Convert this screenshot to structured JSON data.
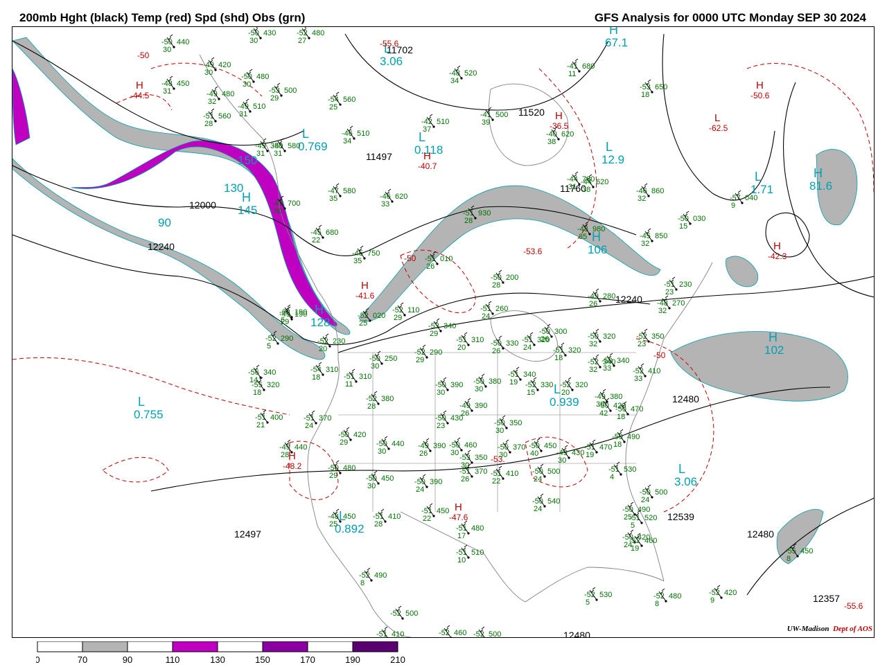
{
  "header": {
    "left_title": "200mb Hght (black) Temp (red) Spd (shd) Obs (grn)",
    "right_title": "GFS Analysis for 0000 UTC Monday  SEP 30 2024"
  },
  "credit": {
    "org": "UW-Madison",
    "dept": "Dept of AOS"
  },
  "colors": {
    "height_contour": "#000000",
    "temp_contour": "#c00000",
    "obs": "#007000",
    "speed_label": "#00a0b0",
    "speed_70_90": "#b4b4b4",
    "speed_110_130": "#c000c0",
    "speed_150_170": "#8a00a0",
    "speed_190_210": "#5a0070",
    "coastline": "#808080"
  },
  "legend": {
    "ticks": [
      "0",
      "70",
      "90",
      "110",
      "130",
      "150",
      "170",
      "190",
      "210"
    ],
    "bins": [
      {
        "label_from": "70",
        "label_to": "90",
        "color": "#b4b4b4"
      },
      {
        "label_from": "110",
        "label_to": "130",
        "color": "#c000c0"
      },
      {
        "label_from": "150",
        "label_to": "170",
        "color": "#8a00a0"
      },
      {
        "label_from": "190",
        "label_to": "210",
        "color": "#5a0070"
      }
    ]
  },
  "height_labels": [
    "11702",
    "11497",
    "11520",
    "11760",
    "12000",
    "12240",
    "12240",
    "12480",
    "12497",
    "12539",
    "12480",
    "12357",
    "12480"
  ],
  "speed_centers": [
    {
      "type": "L",
      "value": "3.06"
    },
    {
      "type": "H",
      "value": "67.1"
    },
    {
      "type": "L",
      "value": "0.769"
    },
    {
      "type": "L",
      "value": "0.118"
    },
    {
      "type": "L",
      "value": "12.9"
    },
    {
      "type": "L",
      "value": "1.71"
    },
    {
      "type": "H",
      "value": "81.6"
    },
    {
      "type": "H",
      "value": "145"
    },
    {
      "type": "H",
      "value": "106"
    },
    {
      "type": "H",
      "value": "128"
    },
    {
      "type": "H",
      "value": "102"
    },
    {
      "type": "L",
      "value": "0.755"
    },
    {
      "type": "L",
      "value": "0.939"
    },
    {
      "type": "L",
      "value": "3.06"
    },
    {
      "type": "L",
      "value": "0.892"
    },
    {
      "type": "",
      "value": "90"
    },
    {
      "type": "",
      "value": "130"
    },
    {
      "type": "",
      "value": "150"
    }
  ],
  "temp_centers": [
    {
      "type": "H",
      "value": "-44.5"
    },
    {
      "type": "H",
      "value": "-50.6"
    },
    {
      "type": "L",
      "value": "-62.5"
    },
    {
      "type": "H",
      "value": "-36.5"
    },
    {
      "type": "H",
      "value": "-40.7"
    },
    {
      "type": "H",
      "value": "-41.6"
    },
    {
      "type": "H",
      "value": "-42.3"
    },
    {
      "type": "H",
      "value": "-48.2"
    },
    {
      "type": "H",
      "value": "-47.6"
    },
    {
      "type": "",
      "value": "-53.6"
    },
    {
      "type": "",
      "value": "-53."
    },
    {
      "type": "",
      "value": "-55.6"
    },
    {
      "type": "",
      "value": "-55.6"
    },
    {
      "type": "",
      "value": "-50"
    },
    {
      "type": "",
      "value": "-50"
    },
    {
      "type": "",
      "value": "-50"
    }
  ],
  "observations": [
    {
      "t": "-50",
      "d": "30",
      "h": "440"
    },
    {
      "t": "-49",
      "d": "30",
      "h": "420"
    },
    {
      "t": "-48",
      "d": "31",
      "h": "450"
    },
    {
      "t": "-49",
      "d": "32",
      "h": "480"
    },
    {
      "t": "-50",
      "d": "30",
      "h": "480"
    },
    {
      "t": "-53",
      "d": "29",
      "h": "500"
    },
    {
      "t": "-49",
      "d": "31",
      "h": "510"
    },
    {
      "t": "-54",
      "d": "25",
      "h": "560"
    },
    {
      "t": "-51",
      "d": "28",
      "h": "560"
    },
    {
      "t": "-49",
      "d": "31",
      "h": "350"
    },
    {
      "t": "-52",
      "d": "27",
      "h": "480"
    },
    {
      "t": "-50",
      "d": "30",
      "h": "430"
    },
    {
      "t": "-48",
      "d": "34",
      "h": "520"
    },
    {
      "t": "-42",
      "d": "37",
      "h": "510"
    },
    {
      "t": "-46",
      "d": "34",
      "h": "510"
    },
    {
      "t": "-41",
      "d": "39",
      "h": "500"
    },
    {
      "t": "-41",
      "d": "11",
      "h": "680"
    },
    {
      "t": "-53",
      "d": "18",
      "h": "650"
    },
    {
      "t": "-40",
      "d": "38",
      "h": "620"
    },
    {
      "t": "-44",
      "d": "38",
      "h": "620"
    },
    {
      "t": "-44",
      "d": "31",
      "h": "760"
    },
    {
      "t": "-46",
      "d": "32",
      "h": "860"
    },
    {
      "t": "-57",
      "d": "9",
      "h": "040"
    },
    {
      "t": "-50",
      "d": "15",
      "h": "030"
    },
    {
      "t": "-45",
      "d": "32",
      "h": "850"
    },
    {
      "t": "-48",
      "d": "35",
      "h": "980"
    },
    {
      "t": "-47",
      "d": "35",
      "h": "580"
    },
    {
      "t": "-46",
      "d": "33",
      "h": "620"
    },
    {
      "t": "-45",
      "d": "22",
      "h": "680"
    },
    {
      "t": "-45",
      "d": "35",
      "h": "750"
    },
    {
      "t": "-49",
      "d": "30",
      "h": "700"
    },
    {
      "t": "-41",
      "d": "31",
      "h": "580"
    },
    {
      "t": "-51",
      "d": "26",
      "h": "010"
    },
    {
      "t": "-51",
      "d": "28",
      "h": "930"
    },
    {
      "t": "-50",
      "d": "28",
      "h": "200"
    },
    {
      "t": "-49",
      "d": "26",
      "h": "280"
    },
    {
      "t": "-51",
      "d": "24",
      "h": "260"
    },
    {
      "t": "-48",
      "d": "32",
      "h": "270"
    },
    {
      "t": "-51",
      "d": "23",
      "h": "230"
    },
    {
      "t": "-49",
      "d": "29",
      "h": "190"
    },
    {
      "t": "-52",
      "d": "25",
      "h": "020"
    },
    {
      "t": "-52",
      "d": "29",
      "h": "110"
    },
    {
      "t": "-53",
      "d": "29",
      "h": "340"
    },
    {
      "t": "-51",
      "d": "20",
      "h": "310"
    },
    {
      "t": "-50",
      "d": "26",
      "h": "330"
    },
    {
      "t": "-51",
      "d": "24",
      "h": "320"
    },
    {
      "t": "-50",
      "d": "26",
      "h": "300"
    },
    {
      "t": "-51",
      "d": "18",
      "h": "320"
    },
    {
      "t": "-50",
      "d": "32",
      "h": "320"
    },
    {
      "t": "-52",
      "d": "23",
      "h": "350"
    },
    {
      "t": "-52",
      "d": "32",
      "h": "340"
    },
    {
      "t": "-52",
      "d": "33",
      "h": "410"
    },
    {
      "t": "-62",
      "d": "6",
      "h": "190"
    },
    {
      "t": "-52",
      "d": "5",
      "h": "290"
    },
    {
      "t": "-52",
      "d": "20",
      "h": "230"
    },
    {
      "t": "-50",
      "d": "30",
      "h": "250"
    },
    {
      "t": "-52",
      "d": "29",
      "h": "290"
    },
    {
      "t": "-56",
      "d": "14",
      "h": "340"
    },
    {
      "t": "-54",
      "d": "18",
      "h": "310"
    },
    {
      "t": "-51",
      "d": "11",
      "h": "310"
    },
    {
      "t": "-55",
      "d": "18",
      "h": "320"
    },
    {
      "t": "-50",
      "d": "30",
      "h": "390"
    },
    {
      "t": "-50",
      "d": "30",
      "h": "380"
    },
    {
      "t": "-51",
      "d": "19",
      "h": "340"
    },
    {
      "t": "-52",
      "d": "15",
      "h": "330"
    },
    {
      "t": "-52",
      "d": "20",
      "h": "320"
    },
    {
      "t": "-50",
      "d": "33",
      "h": "340"
    },
    {
      "t": "-49",
      "d": "30",
      "h": "380"
    },
    {
      "t": "-50",
      "d": "42",
      "h": "420"
    },
    {
      "t": "-50",
      "d": "18",
      "h": "470"
    },
    {
      "t": "-52",
      "d": "28",
      "h": "380"
    },
    {
      "t": "-51",
      "d": "21",
      "h": "400"
    },
    {
      "t": "-51",
      "d": "24",
      "h": "370"
    },
    {
      "t": "-49",
      "d": "26",
      "h": "390"
    },
    {
      "t": "-50",
      "d": "23",
      "h": "430"
    },
    {
      "t": "-50",
      "d": "30",
      "h": "350"
    },
    {
      "t": "-50",
      "d": "29",
      "h": "420"
    },
    {
      "t": "-49",
      "d": "28",
      "h": "440"
    },
    {
      "t": "-50",
      "d": "30",
      "h": "460"
    },
    {
      "t": "-50",
      "d": "30",
      "h": "440"
    },
    {
      "t": "-49",
      "d": "26",
      "h": "390"
    },
    {
      "t": "-53",
      "d": "30",
      "h": "350"
    },
    {
      "t": "-50",
      "d": "30",
      "h": "370"
    },
    {
      "t": "-50",
      "d": "40",
      "h": "450"
    },
    {
      "t": "-49",
      "d": "30",
      "h": "430"
    },
    {
      "t": "-51",
      "d": "19",
      "h": "470"
    },
    {
      "t": "-50",
      "d": "18",
      "h": "490"
    },
    {
      "t": "-50",
      "d": "29",
      "h": "480"
    },
    {
      "t": "-50",
      "d": "30",
      "h": "450"
    },
    {
      "t": "-50",
      "d": "24",
      "h": "390"
    },
    {
      "t": "-51",
      "d": "26",
      "h": "370"
    },
    {
      "t": "-51",
      "d": "22",
      "h": "410"
    },
    {
      "t": "-50",
      "d": "24",
      "h": "500"
    },
    {
      "t": "-51",
      "d": "4",
      "h": "530"
    },
    {
      "t": "-50",
      "d": "24",
      "h": "500"
    },
    {
      "t": "-50",
      "d": "25",
      "h": "490"
    },
    {
      "t": "-48",
      "d": "25",
      "h": "450"
    },
    {
      "t": "-51",
      "d": "28",
      "h": "410"
    },
    {
      "t": "-51",
      "d": "22",
      "h": "450"
    },
    {
      "t": "-51",
      "d": "17",
      "h": "480"
    },
    {
      "t": "-50",
      "d": "24",
      "h": "540"
    },
    {
      "t": "-51",
      "d": "5",
      "h": "520"
    },
    {
      "t": "-50",
      "d": "24",
      "h": "420"
    },
    {
      "t": "-52",
      "d": "19",
      "h": "460"
    },
    {
      "t": "-51",
      "d": "10",
      "h": "510"
    },
    {
      "t": "-52",
      "d": "8",
      "h": "490"
    },
    {
      "t": "-52",
      "d": "",
      "h": "500"
    },
    {
      "t": "-51",
      "d": "",
      "h": "410"
    },
    {
      "t": "-52",
      "d": "",
      "h": "460"
    },
    {
      "t": "-52",
      "d": "10",
      "h": "500"
    },
    {
      "t": "-52",
      "d": "5",
      "h": "530"
    },
    {
      "t": "-52",
      "d": "8",
      "h": "480"
    },
    {
      "t": "-52",
      "d": "9",
      "h": "420"
    },
    {
      "t": "-55",
      "d": "8",
      "h": "450"
    }
  ]
}
